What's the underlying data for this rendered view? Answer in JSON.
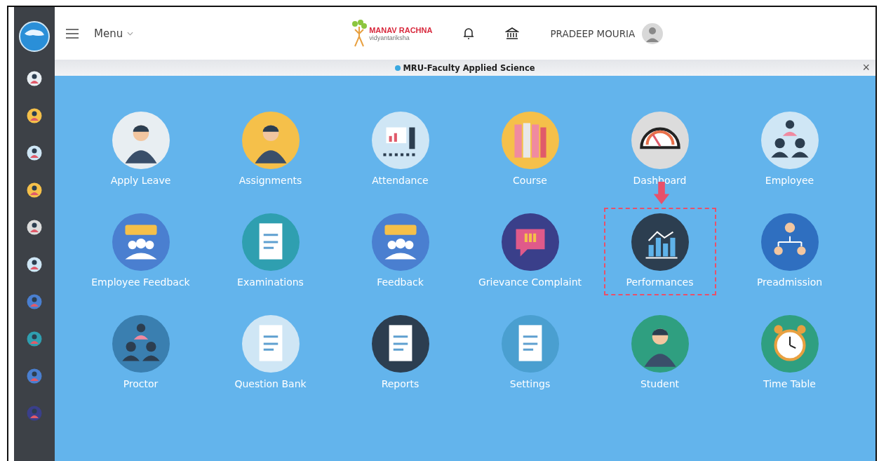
{
  "header": {
    "menu_label": "Menu",
    "logo_title": "MANAV RACHNA",
    "logo_subtitle": "vidyantariksha",
    "user_name": "PRADEEP MOURIA"
  },
  "banner": {
    "text": "MRU-Faculty Applied Science",
    "close": "×"
  },
  "tiles": [
    {
      "label": "Apply Leave",
      "highlighted": false
    },
    {
      "label": "Assignments",
      "highlighted": false
    },
    {
      "label": "Attendance",
      "highlighted": false
    },
    {
      "label": "Course",
      "highlighted": false
    },
    {
      "label": "Dashboard",
      "highlighted": false
    },
    {
      "label": "Employee",
      "highlighted": false
    },
    {
      "label": "Employee Feedback",
      "highlighted": false
    },
    {
      "label": "Examinations",
      "highlighted": false
    },
    {
      "label": "Feedback",
      "highlighted": false
    },
    {
      "label": "Grievance Complaint",
      "highlighted": false
    },
    {
      "label": "Performances",
      "highlighted": true
    },
    {
      "label": "Preadmission",
      "highlighted": false
    },
    {
      "label": "Proctor",
      "highlighted": false
    },
    {
      "label": "Question Bank",
      "highlighted": false
    },
    {
      "label": "Reports",
      "highlighted": false
    },
    {
      "label": "Settings",
      "highlighted": false
    },
    {
      "label": "Student",
      "highlighted": false
    },
    {
      "label": "Time Table",
      "highlighted": false
    }
  ]
}
